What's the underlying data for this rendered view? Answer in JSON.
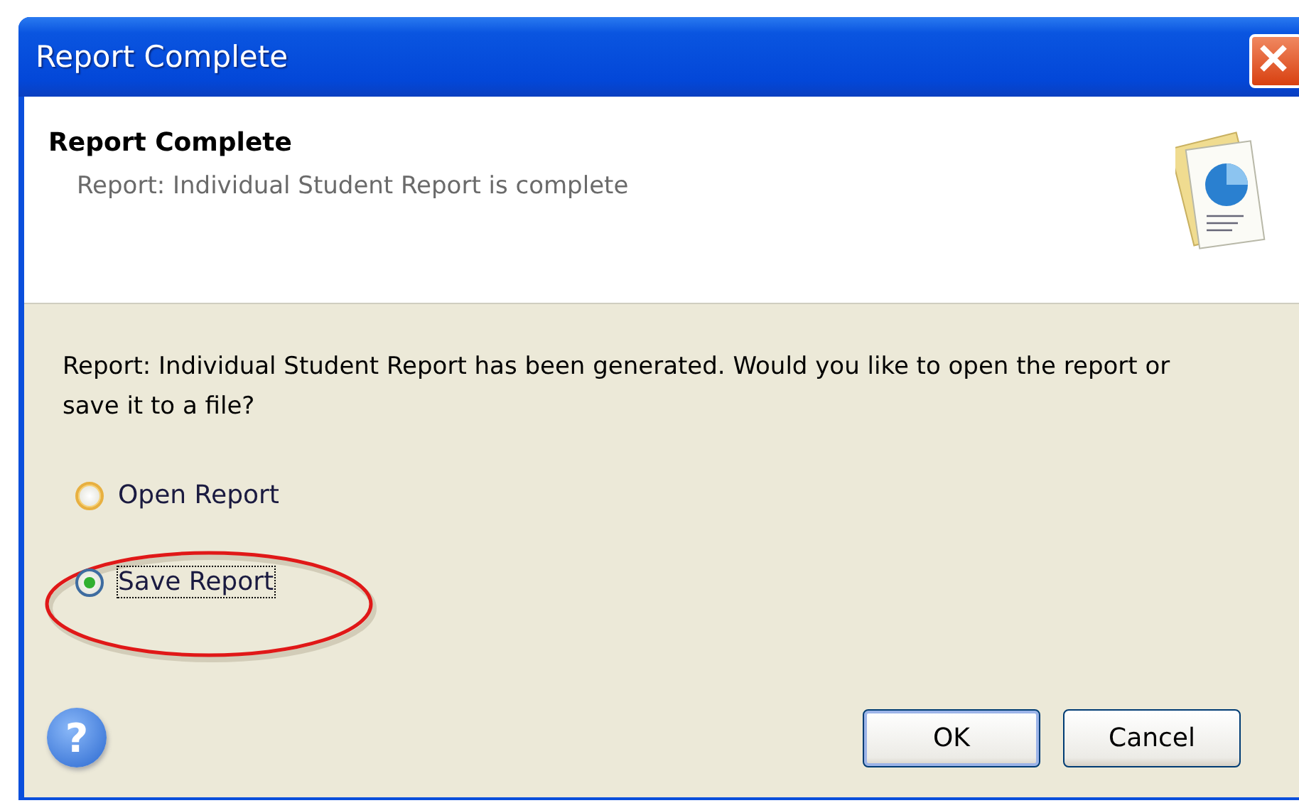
{
  "window": {
    "title": "Report Complete"
  },
  "header": {
    "title": "Report Complete",
    "subtitle": "Report: Individual Student Report is complete"
  },
  "message": "Report: Individual Student Report has been generated. Would you like to open the report or save it to a file?",
  "options": [
    {
      "label": "Open Report",
      "selected": false
    },
    {
      "label": "Save Report",
      "selected": true
    }
  ],
  "help_icon": "?",
  "buttons": [
    {
      "label": "OK",
      "default": true
    },
    {
      "label": "Cancel",
      "default": false
    }
  ]
}
